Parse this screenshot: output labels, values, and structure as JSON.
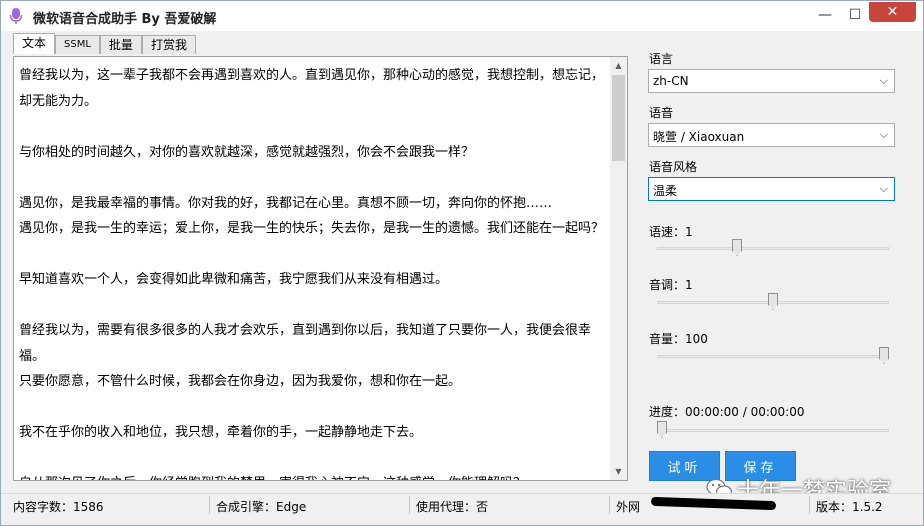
{
  "window": {
    "title": "微软语音合成助手 By 吾爱破解",
    "min_label": "—",
    "max_label": "☐",
    "close_label": "✕"
  },
  "tabs": [
    {
      "label": "文本",
      "active": true
    },
    {
      "label": "SSML",
      "active": false
    },
    {
      "label": "批量",
      "active": false
    },
    {
      "label": "打赏我",
      "active": false
    }
  ],
  "editor": {
    "text": "曾经我以为，这一辈子我都不会再遇到喜欢的人。直到遇见你，那种心动的感觉，我想控制，想忘记，\n却无能为力。\n\n与你相处的时间越久，对你的喜欢就越深，感觉就越强烈，你会不会跟我一样？\n\n遇见你，是我最幸福的事情。你对我的好，我都记在心里。真想不顾一切，奔向你的怀抱……\n遇见你，是我一生的幸运；爱上你，是我一生的快乐；失去你，是我一生的遗憾。我们还能在一起吗？\n\n早知道喜欢一个人，会变得如此卑微和痛苦，我宁愿我们从来没有相遇过。\n\n曾经我以为，需要有很多很多的人我才会欢乐，直到遇到你以后，我知道了只要你一人，我便会很幸\n福。\n只要你愿意，不管什么时候，我都会在你身边，因为我爱你，想和你在一起。\n\n我不在乎你的收入和地位，我只想，牵着你的手，一起静静地走下去。\n\n自从那次见了你之后，你经常跑到我的梦里，害得我心神不宁。这种感觉，你能理解吗？",
    "scroll_up": "▲",
    "scroll_down": "▼"
  },
  "settings": {
    "language_label": "语言",
    "language_value": "zh-CN",
    "voice_label": "语音",
    "voice_value": "晓萱 / Xiaoxuan",
    "style_label": "语音风格",
    "style_value": "温柔",
    "dropdown_arrow": "⌵",
    "speed_label": "语速：1",
    "speed_level": 0.34,
    "pitch_label": "音调：1",
    "pitch_level": 0.5,
    "volume_label": "音量：100",
    "volume_level": 1.0,
    "progress_label": "进度：00:00:00 / 00:00:00",
    "progress_level": 0.0,
    "listen_button": "试听",
    "save_button": "保存"
  },
  "statusbar": {
    "char_count": "内容字数：1586",
    "engine": "合成引擎：Edge",
    "proxy": "使用代理：否",
    "network": "外网",
    "version": "版本：1.5.2"
  },
  "watermark": {
    "text": "十年一梦实验室"
  },
  "colors": {
    "accent_button": "#2b8ee6",
    "close_button": "#c7453b"
  }
}
